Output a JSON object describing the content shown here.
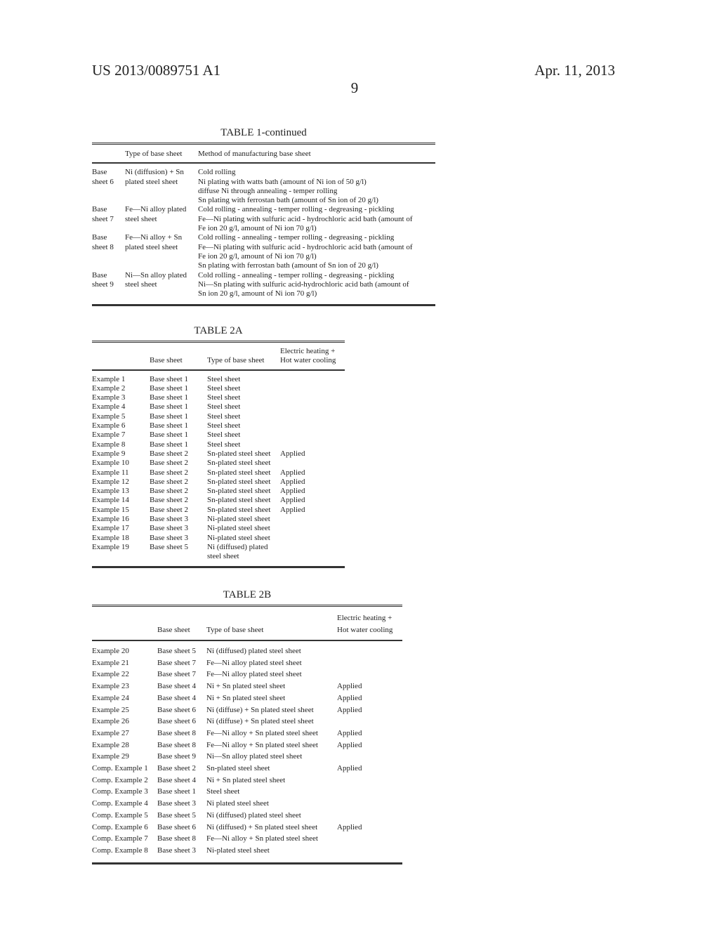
{
  "header": {
    "patent_number": "US 2013/0089751 A1",
    "date": "Apr. 11, 2013",
    "page_number": "9"
  },
  "table1": {
    "title": "TABLE 1-continued",
    "columns": [
      "",
      "Type of base sheet",
      "Method of manufacturing base sheet"
    ],
    "rows": [
      {
        "name": [
          "Base",
          "sheet 6"
        ],
        "type": [
          "Ni (diffusion) + Sn",
          "plated steel sheet"
        ],
        "method": [
          "Cold rolling",
          "Ni plating with watts bath (amount of Ni ion of 50 g/l)",
          "diffuse Ni through annealing - temper rolling",
          "Sn plating with ferrostan bath (amount of Sn ion of 20 g/l)"
        ]
      },
      {
        "name": [
          "Base",
          "sheet 7"
        ],
        "type": [
          "Fe—Ni alloy plated",
          "steel sheet"
        ],
        "method": [
          "Cold rolling - annealing - temper rolling - degreasing - pickling",
          "Fe—Ni plating with sulfuric acid - hydrochloric acid bath (amount of",
          "Fe ion 20 g/l, amount of Ni ion 70 g/l)"
        ]
      },
      {
        "name": [
          "Base",
          "sheet 8"
        ],
        "type": [
          "Fe—Ni alloy + Sn",
          "plated steel sheet"
        ],
        "method": [
          "Cold rolling - annealing - temper rolling - degreasing - pickling",
          "Fe—Ni plating with sulfuric acid - hydrochloric acid bath (amount of",
          "Fe ion 20 g/l, amount of Ni ion 70 g/l)",
          "Sn plating with ferrostan bath (amount of Sn ion of 20 g/l)"
        ]
      },
      {
        "name": [
          "Base",
          "sheet 9"
        ],
        "type": [
          "Ni—Sn alloy plated",
          "steel sheet"
        ],
        "method": [
          "Cold rolling - annealing - temper rolling - degreasing - pickling",
          "Ni—Sn plating with sulfuric acid-hydrochloric acid bath (amount of",
          "Sn ion 20 g/l, amount of Ni ion 70 g/l)"
        ]
      }
    ]
  },
  "table2a": {
    "title": "TABLE 2A",
    "columns": [
      "",
      "Base sheet",
      "Type of base sheet",
      [
        "Electric heating +",
        "Hot water cooling"
      ]
    ],
    "rows": [
      [
        "Example 1",
        "Base sheet 1",
        "Steel sheet",
        ""
      ],
      [
        "Example 2",
        "Base sheet 1",
        "Steel sheet",
        ""
      ],
      [
        "Example 3",
        "Base sheet 1",
        "Steel sheet",
        ""
      ],
      [
        "Example 4",
        "Base sheet 1",
        "Steel sheet",
        ""
      ],
      [
        "Example 5",
        "Base sheet 1",
        "Steel sheet",
        ""
      ],
      [
        "Example 6",
        "Base sheet 1",
        "Steel sheet",
        ""
      ],
      [
        "Example 7",
        "Base sheet 1",
        "Steel sheet",
        ""
      ],
      [
        "Example 8",
        "Base sheet 1",
        "Steel sheet",
        ""
      ],
      [
        "Example 9",
        "Base sheet 2",
        "Sn-plated steel sheet",
        "Applied"
      ],
      [
        "Example 10",
        "Base sheet 2",
        "Sn-plated steel sheet",
        ""
      ],
      [
        "Example 11",
        "Base sheet 2",
        "Sn-plated steel sheet",
        "Applied"
      ],
      [
        "Example 12",
        "Base sheet 2",
        "Sn-plated steel sheet",
        "Applied"
      ],
      [
        "Example 13",
        "Base sheet 2",
        "Sn-plated steel sheet",
        "Applied"
      ],
      [
        "Example 14",
        "Base sheet 2",
        "Sn-plated steel sheet",
        "Applied"
      ],
      [
        "Example 15",
        "Base sheet 2",
        "Sn-plated steel sheet",
        "Applied"
      ],
      [
        "Example 16",
        "Base sheet 3",
        "Ni-plated steel sheet",
        ""
      ],
      [
        "Example 17",
        "Base sheet 3",
        "Ni-plated steel sheet",
        ""
      ],
      [
        "Example 18",
        "Base sheet 3",
        "Ni-plated steel sheet",
        ""
      ],
      [
        "Example 19",
        "Base sheet 5",
        [
          "Ni (diffused) plated",
          "steel sheet"
        ],
        ""
      ]
    ]
  },
  "table2b": {
    "title": "TABLE 2B",
    "columns": [
      "",
      "Base sheet",
      "Type of base sheet",
      [
        "Electric heating +",
        "Hot water cooling"
      ]
    ],
    "rows": [
      [
        "Example 20",
        "Base sheet 5",
        "Ni (diffused) plated steel sheet",
        ""
      ],
      [
        "Example 21",
        "Base sheet 7",
        "Fe—Ni alloy plated steel sheet",
        ""
      ],
      [
        "Example 22",
        "Base sheet 7",
        "Fe—Ni alloy plated steel sheet",
        ""
      ],
      [
        "Example 23",
        "Base sheet 4",
        "Ni + Sn plated steel sheet",
        "Applied"
      ],
      [
        "Example 24",
        "Base sheet 4",
        "Ni + Sn plated steel sheet",
        "Applied"
      ],
      [
        "Example 25",
        "Base sheet 6",
        "Ni (diffuse) + Sn plated steel sheet",
        "Applied"
      ],
      [
        "Example 26",
        "Base sheet 6",
        "Ni (diffuse) + Sn plated steel sheet",
        ""
      ],
      [
        "Example 27",
        "Base sheet 8",
        "Fe—Ni alloy + Sn plated steel sheet",
        "Applied"
      ],
      [
        "Example 28",
        "Base sheet 8",
        "Fe—Ni alloy + Sn plated steel sheet",
        "Applied"
      ],
      [
        "Example 29",
        "Base sheet 9",
        "Ni—Sn alloy plated steel sheet",
        ""
      ],
      [
        "Comp. Example 1",
        "Base sheet 2",
        "Sn-plated steel sheet",
        "Applied"
      ],
      [
        "Comp. Example 2",
        "Base sheet 4",
        "Ni + Sn plated steel sheet",
        ""
      ],
      [
        "Comp. Example 3",
        "Base sheet 1",
        "Steel sheet",
        ""
      ],
      [
        "Comp. Example 4",
        "Base sheet 3",
        "Ni plated steel sheet",
        ""
      ],
      [
        "Comp. Example 5",
        "Base sheet 5",
        "Ni (diffused) plated steel sheet",
        ""
      ],
      [
        "Comp. Example 6",
        "Base sheet 6",
        "Ni (diffused) + Sn plated steel sheet",
        "Applied"
      ],
      [
        "Comp. Example 7",
        "Base sheet 8",
        "Fe—Ni alloy + Sn plated steel sheet",
        ""
      ],
      [
        "Comp. Example 8",
        "Base sheet 3",
        "Ni-plated steel sheet",
        ""
      ]
    ]
  }
}
